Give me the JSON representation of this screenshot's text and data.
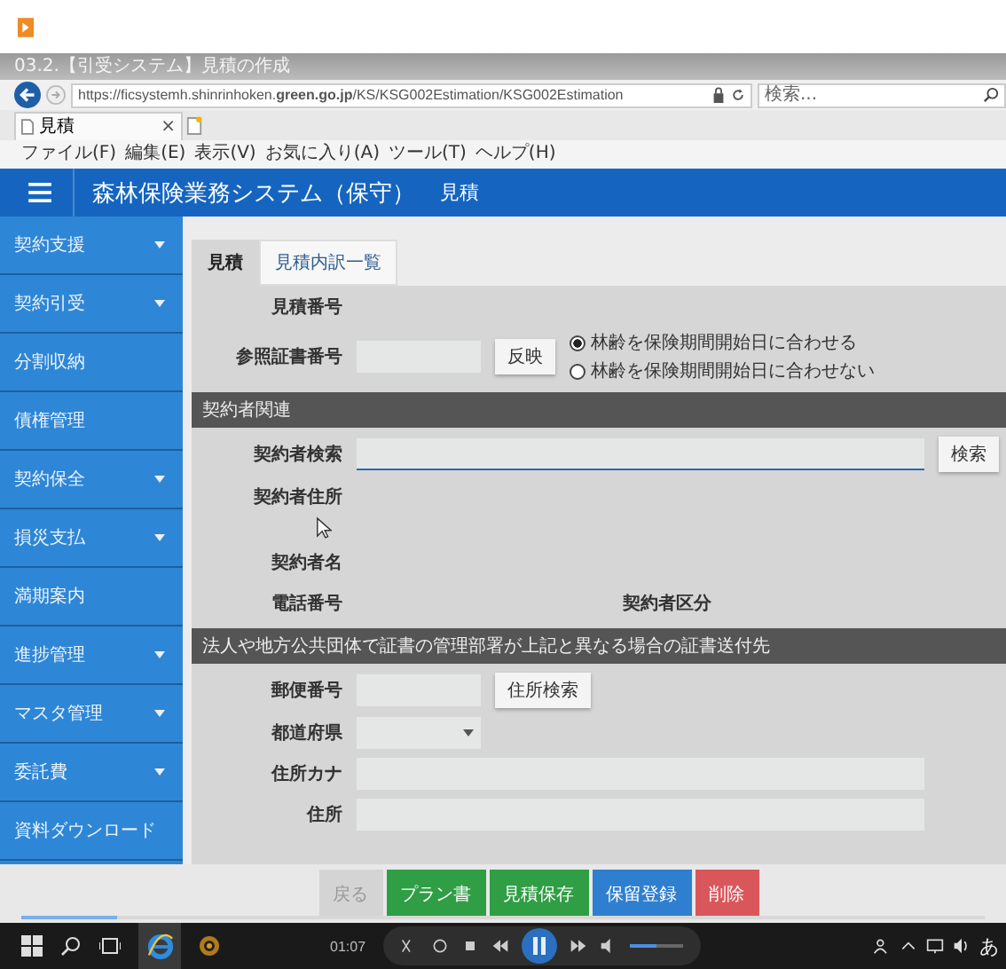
{
  "window": {
    "title": "03.2.【引受システム】見積の作成"
  },
  "address_bar": {
    "url": "https://ficsystemh.shinrinhoken.**green.go.jp**/KS/KSG002Estimation/KSG002Estimation",
    "search_placeholder": "検索..."
  },
  "browser_tabs": [
    {
      "label": "見積",
      "selected": true,
      "close": "×"
    }
  ],
  "menu_bar": [
    "ファイル(F)",
    "編集(E)",
    "表示(V)",
    "お気に入り(A)",
    "ツール(T)",
    "ヘルプ(H)"
  ],
  "app_header": {
    "title": "森林保険業務システム（保守）",
    "page": "見積"
  },
  "sidebar": {
    "items": [
      {
        "label": "契約支援",
        "expandable": true
      },
      {
        "label": "契約引受",
        "expandable": true
      },
      {
        "label": "分割収納",
        "expandable": false
      },
      {
        "label": "債権管理",
        "expandable": false
      },
      {
        "label": "契約保全",
        "expandable": true
      },
      {
        "label": "損災支払",
        "expandable": true
      },
      {
        "label": "満期案内",
        "expandable": false
      },
      {
        "label": "進捗管理",
        "expandable": true
      },
      {
        "label": "マスタ管理",
        "expandable": true
      },
      {
        "label": "委託費",
        "expandable": true
      },
      {
        "label": "資料ダウンロード",
        "expandable": false
      }
    ]
  },
  "tabs": [
    {
      "label": "見積",
      "selected": true
    },
    {
      "label": "見積内訳一覧",
      "selected": false
    }
  ],
  "estimate": {
    "number_label": "見積番号",
    "cert_label": "参照証書番号",
    "reflect_button": "反映",
    "radios": [
      {
        "label": "林齢を保険期間開始日に合わせる",
        "selected": true
      },
      {
        "label": "林齢を保険期間開始日に合わせない",
        "selected": false
      }
    ]
  },
  "contractor_section": {
    "heading": "契約者関連",
    "search_label": "契約者検索",
    "search_focused": true,
    "search_button": "検索",
    "address_label": "契約者住所",
    "name_label": "契約者名",
    "phone_label": "電話番号",
    "type_label": "契約者区分"
  },
  "delivery_section": {
    "heading": "法人や地方公共団体で証書の管理部署が上記と異なる場合の証書送付先",
    "postal_label": "郵便番号",
    "address_search_button": "住所検索",
    "prefecture_label": "都道府県",
    "kana_label": "住所カナ",
    "address_label": "住所"
  },
  "actions": [
    {
      "label": "戻る",
      "color": "#d4d4d4",
      "disabled": true
    },
    {
      "label": "プラン書",
      "color": "#2f9e44",
      "disabled": false
    },
    {
      "label": "見積保存",
      "color": "#2f9e44",
      "disabled": false
    },
    {
      "label": "保留登録",
      "color": "#2f7fd0",
      "disabled": false
    },
    {
      "label": "削除",
      "color": "#d9575b",
      "disabled": false
    }
  ],
  "player": {
    "time": "01:07",
    "seek": {
      "level": 0.1
    },
    "volume": {
      "level": 0.5
    }
  },
  "taskbar": {
    "ime": "あ"
  }
}
